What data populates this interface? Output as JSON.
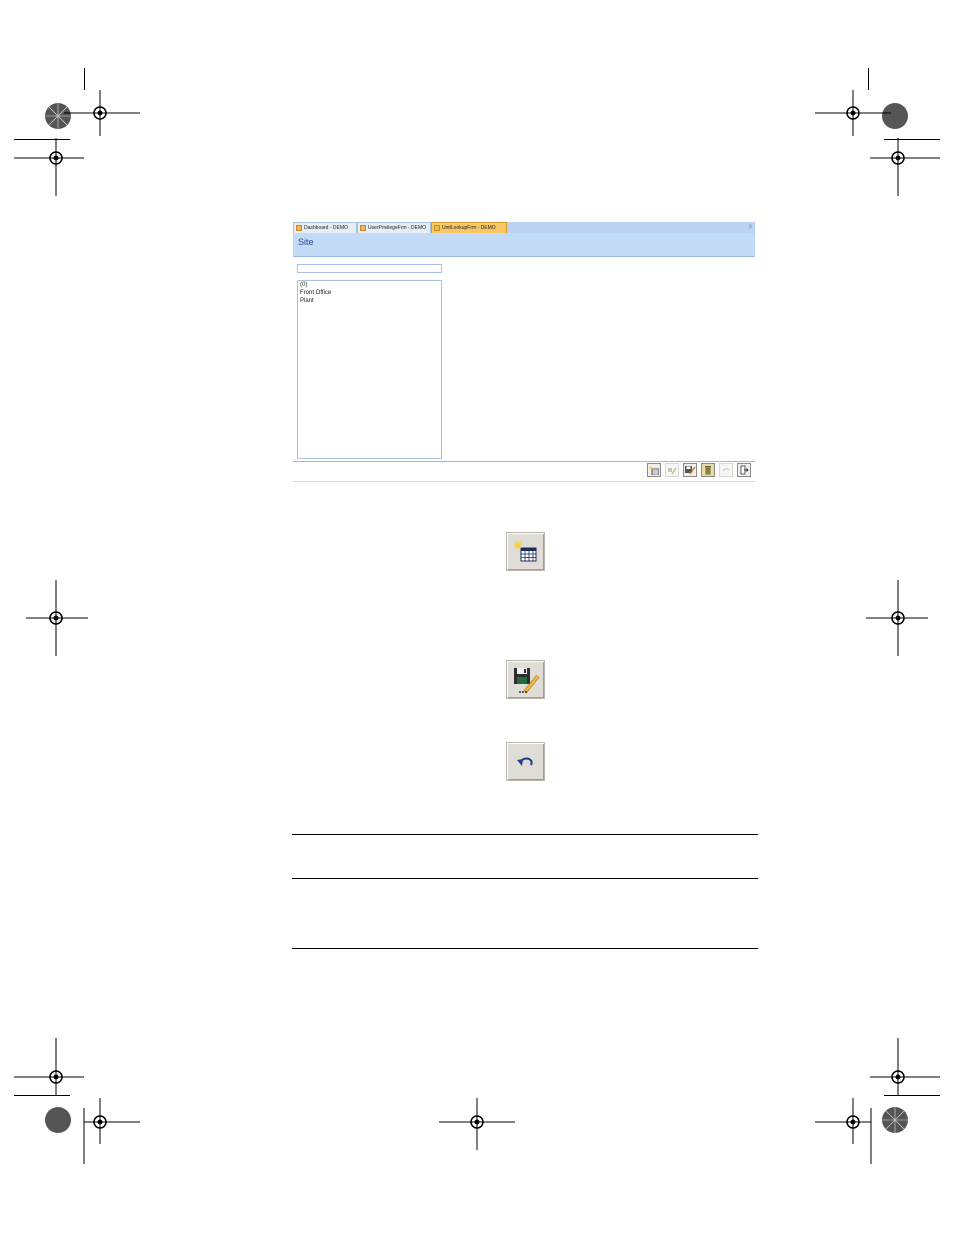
{
  "tabs": [
    {
      "label": "Dashboard - DEMO",
      "active": false
    },
    {
      "label": "UserPrivilegeFrm - DEMO",
      "active": false
    },
    {
      "label": "UnitLookupFrm - DEMO",
      "active": true
    }
  ],
  "tab_close": "x",
  "form": {
    "title": "Site",
    "filter_value": "",
    "list_items": [
      "(0)",
      "Front Office",
      "Plant"
    ]
  },
  "toolbar": {
    "buttons": [
      {
        "name": "new-record-button",
        "icon": "new-record-icon",
        "enabled": true
      },
      {
        "name": "edit-button",
        "icon": "edit-icon",
        "enabled": false
      },
      {
        "name": "save-button",
        "icon": "save-icon",
        "enabled": true
      },
      {
        "name": "delete-button",
        "icon": "trash-icon",
        "enabled": true
      },
      {
        "name": "undo-button",
        "icon": "undo-icon",
        "enabled": false
      },
      {
        "name": "exit-button",
        "icon": "exit-icon",
        "enabled": true
      }
    ]
  },
  "large_icons": [
    "new-record-icon",
    "save-edit-icon",
    "undo-icon"
  ],
  "colors": {
    "tab_active": "#f8c766",
    "title_band": "#c4dbf7",
    "title_text": "#27468f",
    "button_face": "#e0ddd6"
  }
}
